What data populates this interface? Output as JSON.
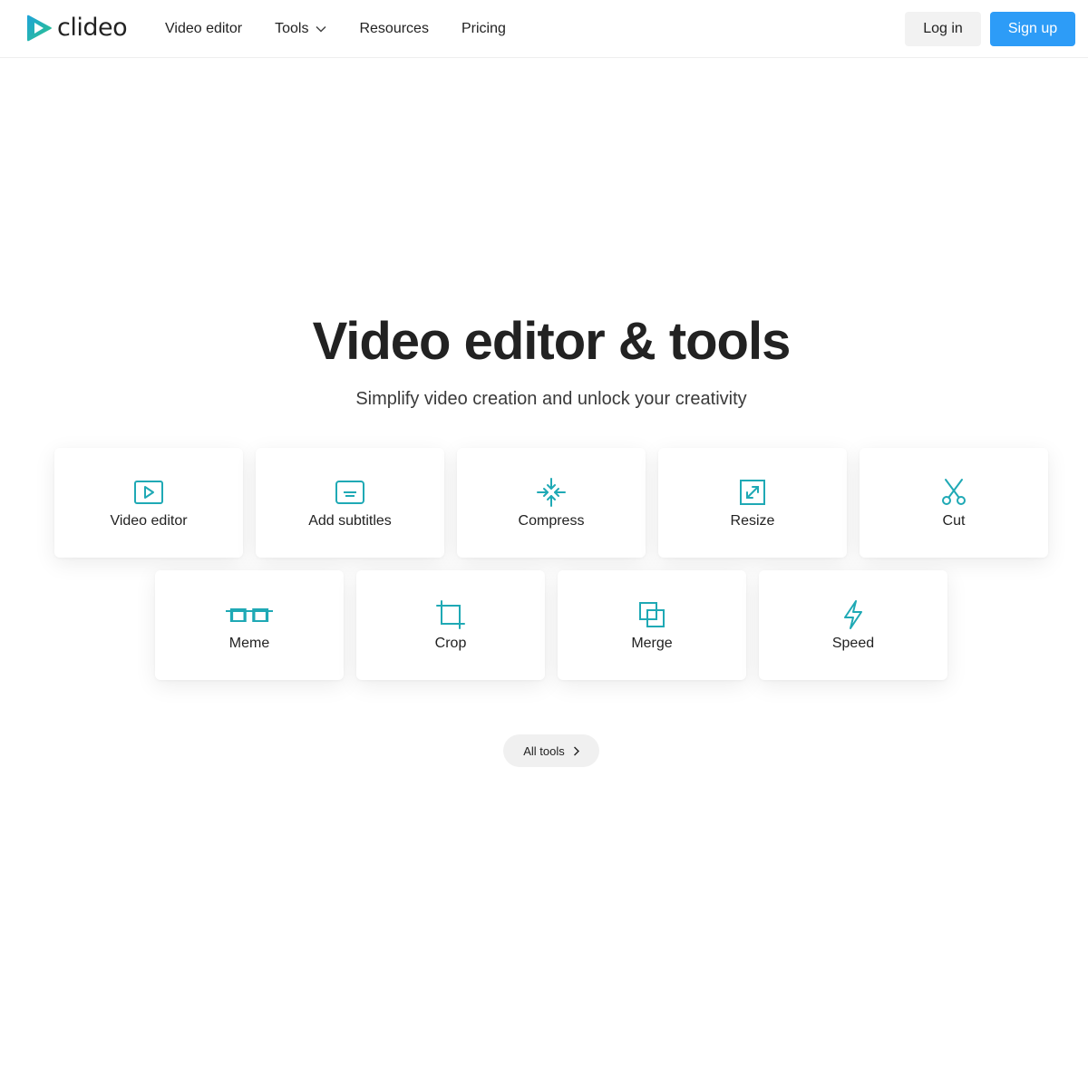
{
  "brand": {
    "name": "clideo"
  },
  "nav": {
    "items": [
      {
        "label": "Video editor"
      },
      {
        "label": "Tools"
      },
      {
        "label": "Resources"
      },
      {
        "label": "Pricing"
      }
    ]
  },
  "auth": {
    "login_label": "Log in",
    "signup_label": "Sign up"
  },
  "hero": {
    "title": "Video editor & tools",
    "subtitle": "Simplify video creation and unlock your creativity"
  },
  "tools": [
    {
      "label": "Video editor",
      "icon": "play-icon"
    },
    {
      "label": "Add subtitles",
      "icon": "subtitles-icon"
    },
    {
      "label": "Compress",
      "icon": "compress-icon"
    },
    {
      "label": "Resize",
      "icon": "resize-icon"
    },
    {
      "label": "Cut",
      "icon": "scissors-icon"
    },
    {
      "label": "Meme",
      "icon": "meme-icon"
    },
    {
      "label": "Crop",
      "icon": "crop-icon"
    },
    {
      "label": "Merge",
      "icon": "merge-icon"
    },
    {
      "label": "Speed",
      "icon": "lightning-icon"
    }
  ],
  "all_tools": {
    "label": "All tools"
  },
  "colors": {
    "accent": "#2d9cf7",
    "icon": "#1fa9b5",
    "logo_green": "#2bc48a",
    "logo_blue": "#1fa3d9",
    "text": "#222222"
  }
}
